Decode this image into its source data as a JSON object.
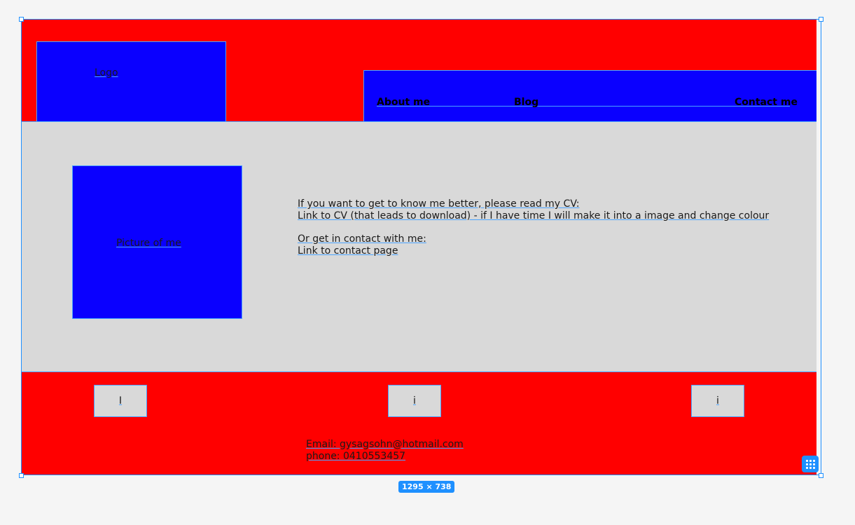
{
  "header": {
    "logo_label": "Logo",
    "nav": {
      "about": "About me",
      "blog": "Blog",
      "contact": "Contact me"
    }
  },
  "main": {
    "picture_label": "Picture of me",
    "cv_prompt": "If you want to get to know me better, please read my CV:",
    "cv_link": "Link to CV (that leads to download) - if I have time I will make it into a image and change colour",
    "contact_prompt": "Or get in contact with me:",
    "contact_link": "Link to contact page"
  },
  "footer": {
    "social_buttons": [
      "I",
      "i",
      "i"
    ],
    "email": "Email: gysagsohn@hotmail.com",
    "phone": "phone: 0410553457"
  },
  "editor": {
    "frame_size": "1295 × 738"
  },
  "colors": {
    "red": "#ff0000",
    "blue": "#0a00ff",
    "grey": "#d9d9d9",
    "selection": "#1e90ff"
  },
  "icons": {
    "grid": "grid-icon"
  }
}
